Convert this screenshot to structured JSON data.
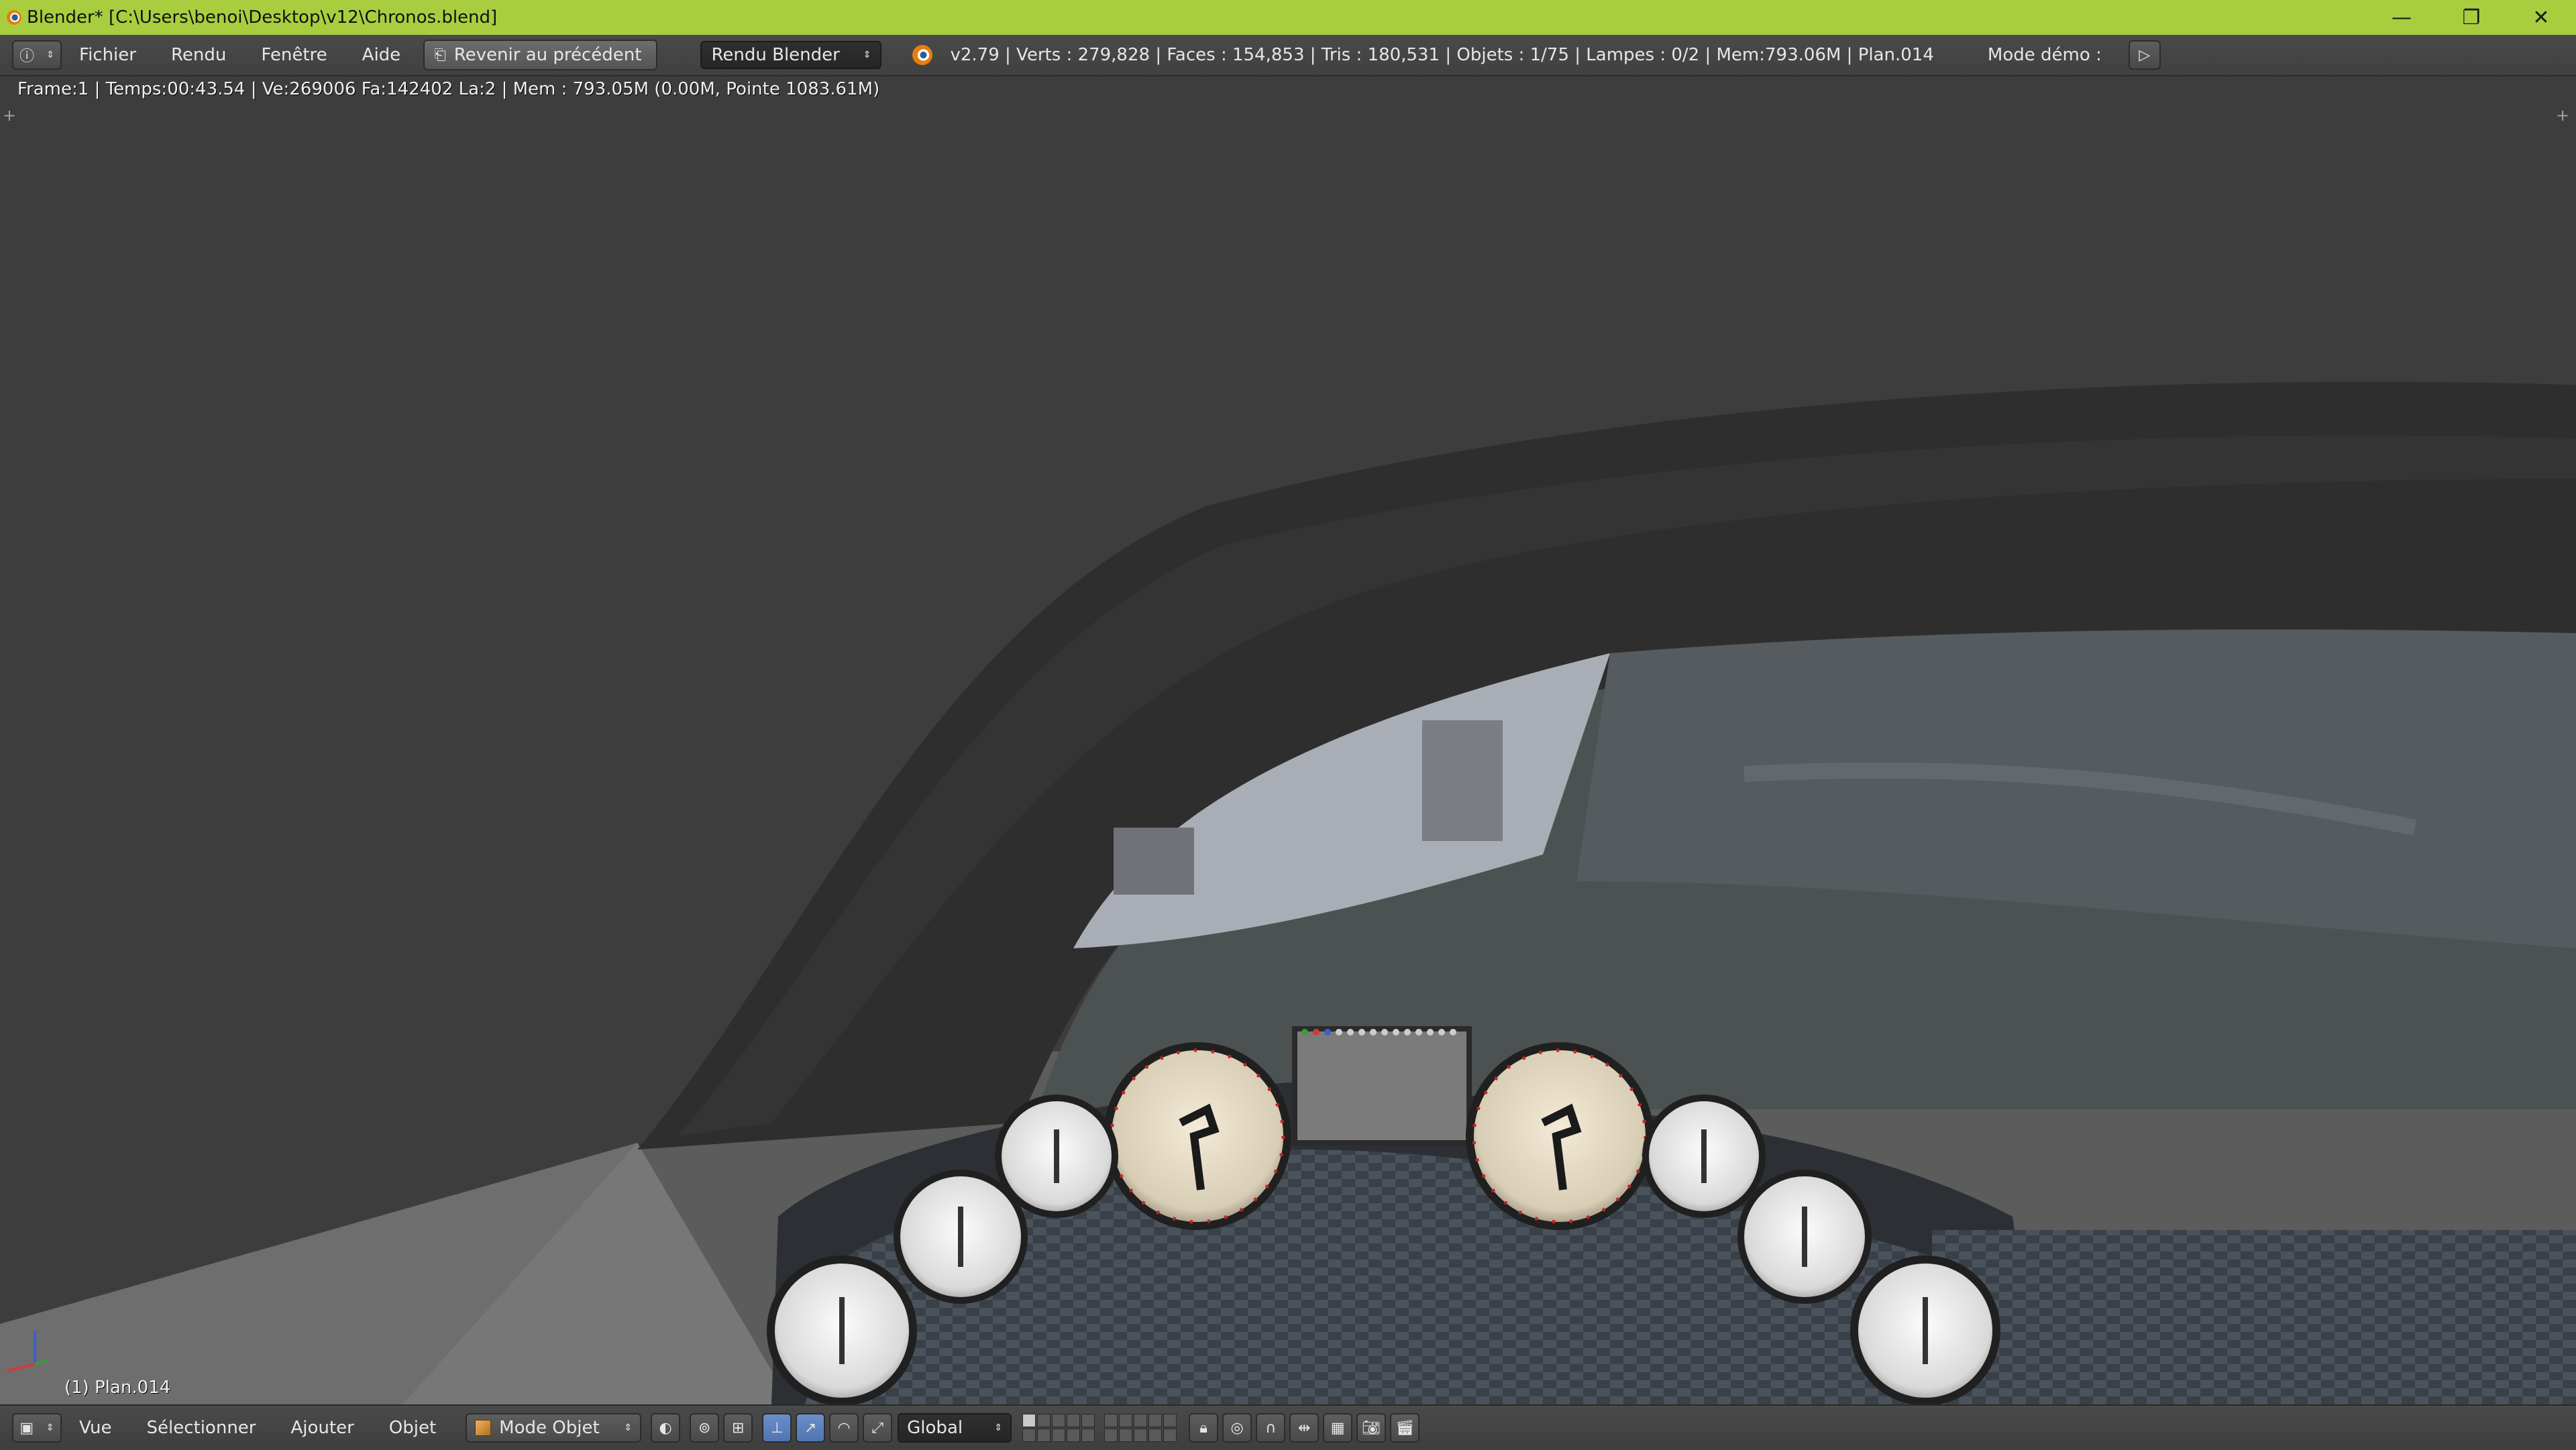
{
  "window": {
    "title": "Blender* [C:\\Users\\benoi\\Desktop\\v12\\Chronos.blend]",
    "minimize": "—",
    "maximize": "❐",
    "close": "✕"
  },
  "info_header": {
    "editor_icon": "info-icon",
    "menus": [
      "Fichier",
      "Rendu",
      "Fenêtre",
      "Aide"
    ],
    "back_button": "Revenir au précédent",
    "render_engine": "Rendu Blender",
    "stats": "v2.79 | Verts  : 279,828 | Faces  : 154,853 | Tris  : 180,531 | Objets  : 1/75 | Lampes  : 0/2 | Mem:793.06M | Plan.014",
    "demo_mode": "Mode démo  :",
    "play_icon": "play-icon"
  },
  "viewport": {
    "render_info": "Frame:1 | Temps:00:43.54 | Ve:269006 Fa:142402 La:2 | Mem  : 793.05M (0.00M, Pointe 1083.61M)",
    "object_label": "(1) Plan.014",
    "axis_x_color": "#d13b3b",
    "axis_y_color": "#3b9b3b",
    "axis_z_color": "#3b5fd1"
  },
  "bottom_header": {
    "menus": [
      "Vue",
      "Sélectionner",
      "Ajouter",
      "Objet"
    ],
    "mode": "Mode Objet",
    "orientation": "Global"
  }
}
